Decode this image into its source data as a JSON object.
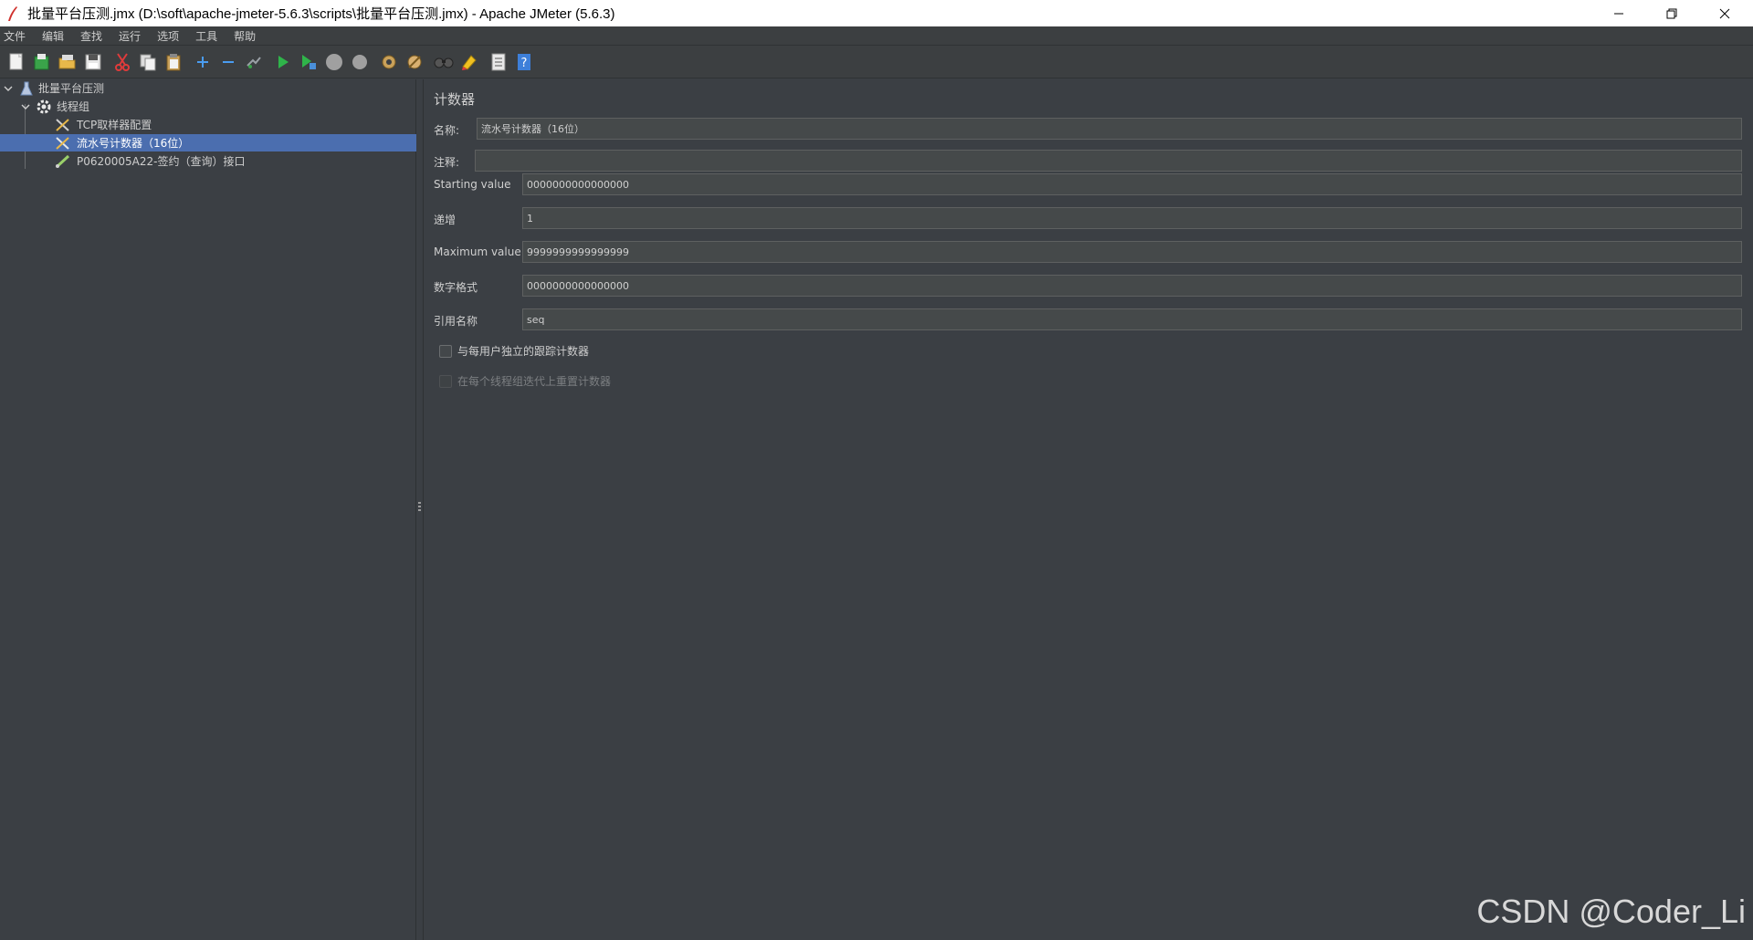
{
  "window": {
    "title": "批量平台压测.jmx (D:\\soft\\apache-jmeter-5.6.3\\scripts\\批量平台压测.jmx) - Apache JMeter (5.6.3)"
  },
  "menu": {
    "items": [
      {
        "label": "文件"
      },
      {
        "label": "编辑"
      },
      {
        "label": "查找"
      },
      {
        "label": "运行"
      },
      {
        "label": "选项"
      },
      {
        "label": "工具"
      },
      {
        "label": "帮助"
      }
    ]
  },
  "toolbar": {
    "icons": [
      "new-icon",
      "templates-icon",
      "open-icon",
      "save-icon",
      "cut-icon",
      "copy-icon",
      "paste-icon",
      "expand-icon",
      "collapse-icon",
      "toggle-icon",
      "start-icon",
      "start-no-pause-icon",
      "stop-icon",
      "shutdown-icon",
      "clear-icon",
      "clear-all-icon",
      "search-icon",
      "reset-search-icon",
      "function-helper-icon",
      "help-icon"
    ]
  },
  "tree": {
    "nodes": [
      {
        "label": "批量平台压测",
        "icon": "test-plan-icon"
      },
      {
        "label": "线程组",
        "icon": "thread-group-icon"
      },
      {
        "label": "TCP取样器配置",
        "icon": "config-element-icon"
      },
      {
        "label": "流水号计数器（16位）",
        "icon": "config-element-icon",
        "selected": true
      },
      {
        "label": "P0620005A22-签约（查询）接口",
        "icon": "sampler-icon"
      }
    ]
  },
  "form": {
    "title": "计数器",
    "name_label": "名称:",
    "name_value": "流水号计数器（16位）",
    "comment_label": "注释:",
    "comment_value": "",
    "start_label": "Starting value",
    "start_value": "0000000000000000",
    "incr_label": "递增",
    "incr_value": "1",
    "max_label": "Maximum value",
    "max_value": "9999999999999999",
    "format_label": "数字格式",
    "format_value": "0000000000000000",
    "ref_label": "引用名称",
    "ref_value": "seq",
    "per_user_label": "与每用户独立的跟踪计数器",
    "per_user_checked": false,
    "reset_label": "在每个线程组迭代上重置计数器",
    "reset_checked": false,
    "reset_enabled": false
  },
  "watermark": "CSDN @Coder_Li"
}
